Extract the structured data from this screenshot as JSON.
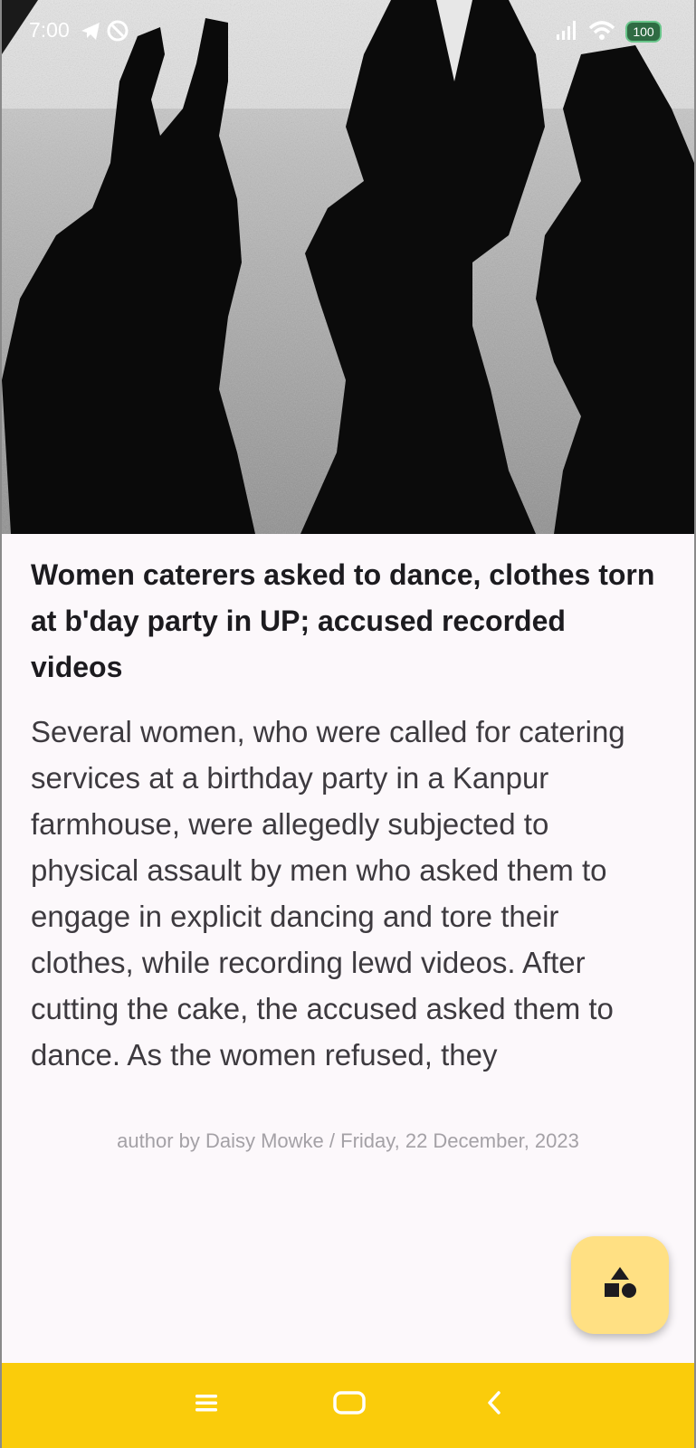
{
  "status_bar": {
    "time": "7:00",
    "battery": "100",
    "icons": [
      "telegram-icon",
      "vpn-icon",
      "signal-icon",
      "wifi-icon",
      "battery-icon"
    ]
  },
  "hero_image": {
    "description_icon": "photo-shadows"
  },
  "article": {
    "headline": "Women caterers asked to dance, clothes torn at b'day party in UP; accused recorded videos",
    "body": "Several women, who were called for catering services at a birthday party in a Kanpur farmhouse, were allegedly subjected to physical assault by men who asked them to engage in explicit dancing and tore their clothes, while recording lewd videos. After cutting the cake, the accused asked them to dance. As the women refused, they",
    "byline": "author by Daisy Mowke / Friday, 22 December, 2023"
  },
  "fab": {
    "icon": "shapes-icon"
  },
  "nav_bar": {
    "buttons": [
      "menu-icon",
      "home-icon",
      "back-icon"
    ]
  },
  "colors": {
    "background": "#fcf8fb",
    "nav_bar": "#facc0b",
    "fab": "#ffe083",
    "headline": "#1c1b1f",
    "byline": "#a4a1a6"
  }
}
